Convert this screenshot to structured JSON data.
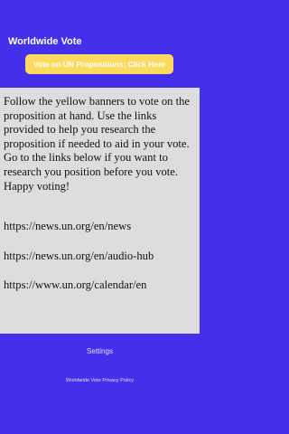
{
  "header": {
    "title": "Worldwide Vote",
    "vote_banner_label": "Vote on UN Propositions: Click Here"
  },
  "main": {
    "intro": "Follow the yellow banners to vote on the proposition at hand. Use the links provided to help you research the proposition if needed to aid in your vote. Go to the links below if you want to research you position before you vote. Happy voting!",
    "links": [
      "https://news.un.org/en/news",
      "https://news.un.org/en/audio-hub",
      "https://www.un.org/calendar/en"
    ]
  },
  "footer": {
    "settings_label": "Settings",
    "privacy_label": "Worldwide Vote Privacy Policy"
  },
  "colors": {
    "background": "#4430ea",
    "banner": "#fcd95f",
    "panel": "#dddddd"
  }
}
